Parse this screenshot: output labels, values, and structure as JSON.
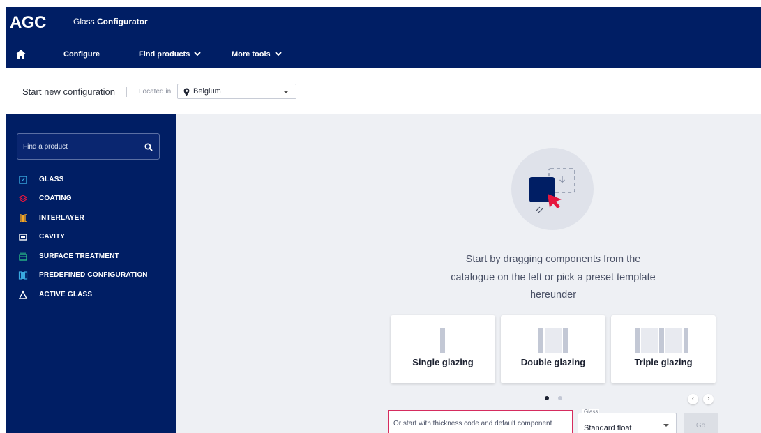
{
  "header": {
    "logo_text": "AGC",
    "app_title_prefix": "Glass ",
    "app_title_bold": "Configurator",
    "nav": [
      {
        "label": "Configure"
      },
      {
        "label": "Find products"
      },
      {
        "label": "More tools"
      }
    ]
  },
  "subheader": {
    "start_label": "Start new configuration",
    "located_label": "Located in",
    "country": "Belgium"
  },
  "sidebar": {
    "search_placeholder": "Find a product",
    "categories": [
      {
        "label": "GLASS",
        "icon": "glass-icon",
        "color": "#39a9e0"
      },
      {
        "label": "COATING",
        "icon": "coating-icon",
        "color": "#e6163e"
      },
      {
        "label": "INTERLAYER",
        "icon": "interlayer-icon",
        "color": "#f5a623"
      },
      {
        "label": "CAVITY",
        "icon": "cavity-icon",
        "color": "#ffffff"
      },
      {
        "label": "SURFACE TREATMENT",
        "icon": "surface-treatment-icon",
        "color": "#2bc48a"
      },
      {
        "label": "PREDEFINED CONFIGURATION",
        "icon": "predefined-configuration-icon",
        "color": "#39a9e0"
      },
      {
        "label": "ACTIVE GLASS",
        "icon": "active-glass-icon",
        "color": "#ffffff"
      }
    ]
  },
  "main": {
    "instruction_lines": [
      "Start by dragging components from the",
      "catalogue on the left or pick a preset template",
      "hereunder"
    ],
    "templates": [
      {
        "label": "Single glazing"
      },
      {
        "label": "Double glazing"
      },
      {
        "label": "Triple glazing"
      }
    ],
    "thickness_placeholder": "Or start with thickness code and default component",
    "glass_legend": "Glass",
    "glass_value": "Standard float",
    "go_label": "Go"
  },
  "colors": {
    "brand_navy": "#001e64",
    "accent_pink": "#d62c5e",
    "accent_red": "#e6163e"
  }
}
